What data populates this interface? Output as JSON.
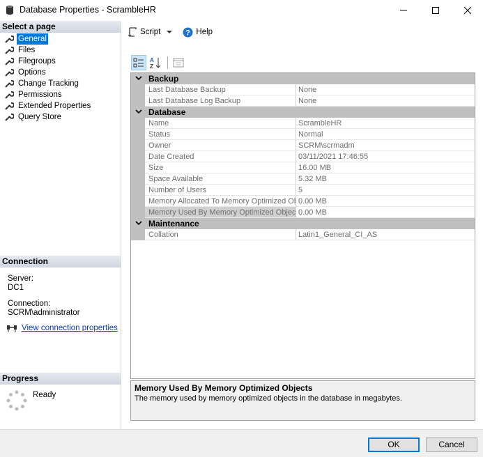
{
  "window": {
    "title": "Database Properties - ScrambleHR"
  },
  "left": {
    "select_page_header": "Select a page",
    "pages": [
      {
        "label": "General",
        "selected": true
      },
      {
        "label": "Files"
      },
      {
        "label": "Filegroups"
      },
      {
        "label": "Options"
      },
      {
        "label": "Change Tracking"
      },
      {
        "label": "Permissions"
      },
      {
        "label": "Extended Properties"
      },
      {
        "label": "Query Store"
      }
    ],
    "connection_header": "Connection",
    "server_label": "Server:",
    "server_value": "DC1",
    "connection_label": "Connection:",
    "connection_value": "SCRM\\administrator",
    "view_connection_link": "View connection properties",
    "progress_header": "Progress",
    "progress_status": "Ready"
  },
  "toolbar": {
    "script_label": "Script",
    "help_label": "Help"
  },
  "grid": {
    "categories": [
      {
        "name": "Backup",
        "props": [
          {
            "name": "Last Database Backup",
            "value": "None"
          },
          {
            "name": "Last Database Log Backup",
            "value": "None"
          }
        ]
      },
      {
        "name": "Database",
        "props": [
          {
            "name": "Name",
            "value": "ScrambleHR"
          },
          {
            "name": "Status",
            "value": "Normal"
          },
          {
            "name": "Owner",
            "value": "SCRM\\scrmadm"
          },
          {
            "name": "Date Created",
            "value": "03/11/2021 17:46:55"
          },
          {
            "name": "Size",
            "value": "16.00 MB"
          },
          {
            "name": "Space Available",
            "value": "5.32 MB"
          },
          {
            "name": "Number of Users",
            "value": "5"
          },
          {
            "name": "Memory Allocated To Memory Optimized Obje",
            "value": "0.00 MB"
          },
          {
            "name": "Memory Used By Memory Optimized Objects",
            "value": "0.00 MB",
            "selected": true
          }
        ]
      },
      {
        "name": "Maintenance",
        "props": [
          {
            "name": "Collation",
            "value": "Latin1_General_CI_AS"
          }
        ]
      }
    ]
  },
  "description": {
    "title": "Memory Used By Memory Optimized Objects",
    "text": "The memory used by memory optimized objects in the database in megabytes."
  },
  "footer": {
    "ok_label": "OK",
    "cancel_label": "Cancel"
  },
  "colors": {
    "selection": "#0078d7",
    "link": "#0a3cb4",
    "category_bg": "#c0c0c0"
  }
}
